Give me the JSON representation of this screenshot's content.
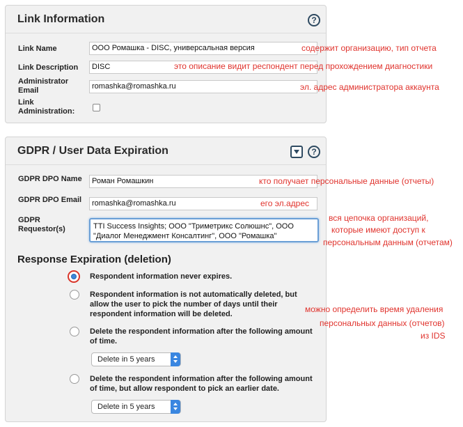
{
  "link_info": {
    "title": "Link Information",
    "fields": {
      "name_label": "Link Name",
      "name_value": "ООО Ромашка - DISC, универсальная версия",
      "description_label": "Link Description",
      "description_value": "DISC",
      "admin_email_label": "Administrator Email",
      "admin_email_value": "romashka@romashka.ru",
      "admin_label": "Link Administration:"
    },
    "notes": {
      "name": "содержит организацию, тип отчета",
      "description": "это описание видит респондент перед прохождением диагностики",
      "admin_email": "эл. адрес администратора аккаунта"
    }
  },
  "gdpr": {
    "title": "GDPR / User Data Expiration",
    "fields": {
      "dpo_name_label": "GDPR DPO Name",
      "dpo_name_value": "Роман Ромашкин",
      "dpo_email_label": "GDPR DPO Email",
      "dpo_email_value": "romashka@romashka.ru",
      "requestor_label": "GDPR Requestor(s)",
      "requestor_value": "TTI Success Insights; ООО \"Триметрикс Солюшнс\", ООО \"Диалог Менеджмент Консалтинг\", ООО \"Ромашка\""
    },
    "notes": {
      "dpo_name": "кто получает персональные данные (отчеты)",
      "dpo_email": "его эл.адрес",
      "requestor_1": "вся цепочка организаций,",
      "requestor_2": "которые имеют доступ к",
      "requestor_3": "персональным данным (отчетам)",
      "expiration_1": "можно определить время удаления",
      "expiration_2": "персональных данных (отчетов)",
      "expiration_3": "из IDS"
    },
    "response_expiration": {
      "title": "Response Expiration (deletion)",
      "options": [
        {
          "label": "Respondent information never expires.",
          "selected": true
        },
        {
          "label": "Respondent information is not automatically deleted, but allow the user to pick the number of days until their respondent information will be deleted.",
          "selected": false
        },
        {
          "label": "Delete the respondent information after the following amount of time.",
          "selected": false
        },
        {
          "label": "Delete the respondent information after the following amount of time, but allow respondent to pick an earlier date.",
          "selected": false
        }
      ],
      "select_1_value": "Delete in 5 years",
      "select_2_value": "Delete in 5 years"
    }
  },
  "colors": {
    "annotation": "#e0332d",
    "panel_bg": "#f1f1f1",
    "accent": "#3a86e0",
    "icon": "#2e4a61"
  },
  "icons": [
    "help-icon",
    "collapse-icon",
    "select-arrow-icon",
    "resize-handle-icon"
  ]
}
